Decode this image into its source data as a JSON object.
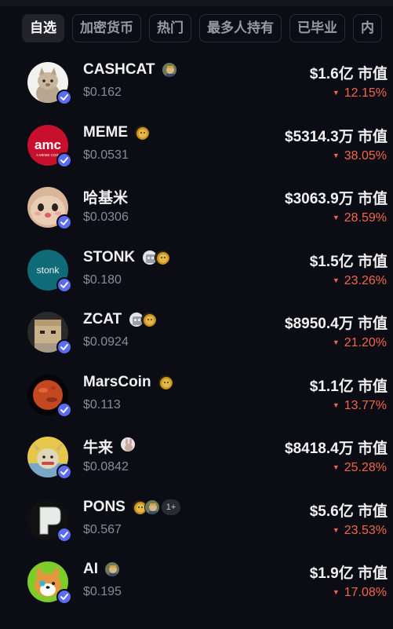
{
  "tabs": [
    "自选",
    "加密货币",
    "热门",
    "最多人持有",
    "已毕业",
    "内"
  ],
  "active_tab": 0,
  "down_arrow": "▼",
  "check_icon": "verified-check-icon",
  "colors": {
    "background": "#0c0c14",
    "down": "#f4664a",
    "verified": "#5b6cf2",
    "muted": "#8b8b96"
  },
  "rows": [
    {
      "name": "CASHCAT",
      "price": "$0.162",
      "cap": "$1.6亿 市值",
      "change": "12.15%",
      "avatar": "cat-avatar",
      "badges": [
        "trader-badge-icon"
      ],
      "more": ""
    },
    {
      "name": "MEME",
      "price": "$0.0531",
      "cap": "$5314.3万 市值",
      "change": "38.05%",
      "avatar": "amc-avatar",
      "badges": [
        "doge-badge-icon"
      ],
      "more": ""
    },
    {
      "name": "哈基米",
      "price": "$0.0306",
      "cap": "$3063.9万 市值",
      "change": "28.59%",
      "avatar": "hachimi-cat-avatar",
      "badges": [],
      "more": ""
    },
    {
      "name": "STONK",
      "price": "$0.180",
      "cap": "$1.5亿 市值",
      "change": "23.26%",
      "avatar": "stonk-avatar",
      "badges": [
        "robot-badge-icon",
        "doge-badge-icon"
      ],
      "more": ""
    },
    {
      "name": "ZCAT",
      "price": "$0.0924",
      "cap": "$8950.4万 市值",
      "change": "21.20%",
      "avatar": "boxcat-avatar",
      "badges": [
        "robot-badge-icon",
        "doge-badge-icon"
      ],
      "more": ""
    },
    {
      "name": "MarsCoin",
      "price": "$0.113",
      "cap": "$1.1亿 市值",
      "change": "13.77%",
      "avatar": "mars-avatar",
      "badges": [
        "doge-badge-icon"
      ],
      "more": ""
    },
    {
      "name": "牛来",
      "price": "$0.0842",
      "cap": "$8418.4万 市值",
      "change": "25.28%",
      "avatar": "bull-avatar",
      "badges": [
        "rabbit-badge-icon"
      ],
      "more": ""
    },
    {
      "name": "PONS",
      "price": "$0.567",
      "cap": "$5.6亿 市值",
      "change": "23.53%",
      "avatar": "pons-avatar",
      "badges": [
        "doge-badge-icon",
        "trader-badge-icon"
      ],
      "more": "1+"
    },
    {
      "name": "AI",
      "price": "$0.195",
      "cap": "$1.9亿 市值",
      "change": "17.08%",
      "avatar": "shiba-avatar",
      "badges": [
        "trader-badge-icon"
      ],
      "more": ""
    }
  ]
}
